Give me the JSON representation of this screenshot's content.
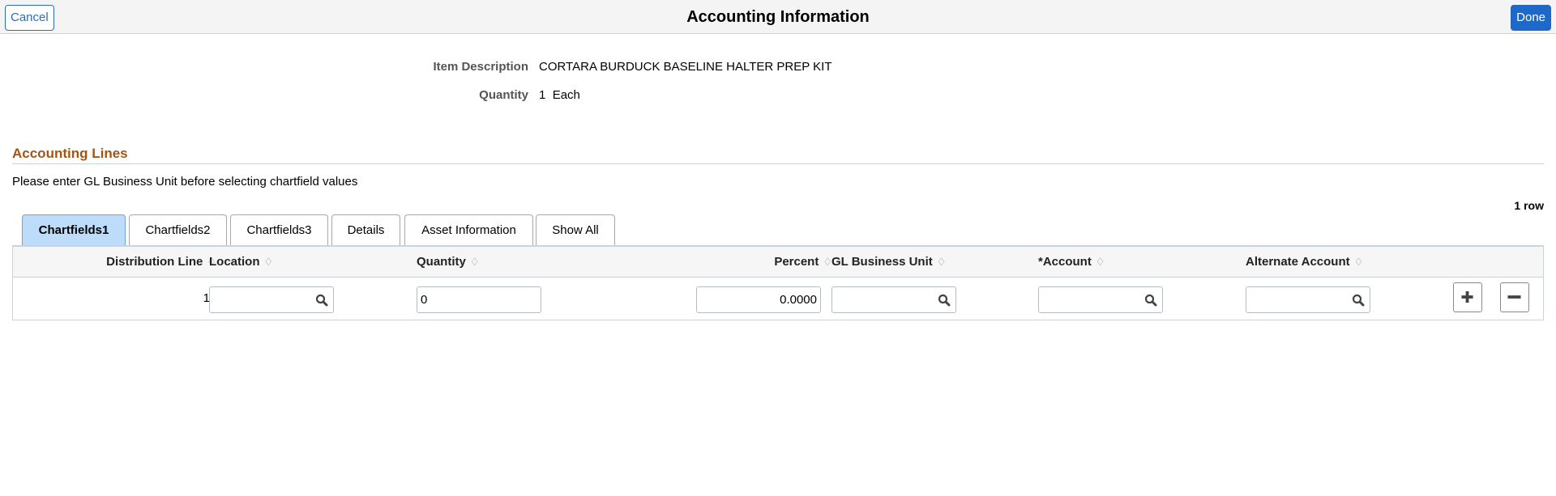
{
  "header": {
    "title": "Accounting Information",
    "cancel_label": "Cancel",
    "done_label": "Done"
  },
  "item_info": {
    "description_label": "Item Description",
    "description_value": "CORTARA BURDUCK BASELINE HALTER PREP KIT",
    "quantity_label": "Quantity",
    "quantity_value": "1",
    "quantity_uom": "Each"
  },
  "accounting_lines": {
    "section_title": "Accounting Lines",
    "instruction": "Please enter GL Business Unit before selecting chartfield values",
    "row_count": "1 row",
    "tabs": [
      {
        "label": "Chartfields1",
        "active": true
      },
      {
        "label": "Chartfields2",
        "active": false
      },
      {
        "label": "Chartfields3",
        "active": false
      },
      {
        "label": "Details",
        "active": false
      },
      {
        "label": "Asset Information",
        "active": false
      },
      {
        "label": "Show All",
        "active": false
      }
    ],
    "columns": [
      {
        "label": "Distribution Line",
        "sort_icon": "sort-updown-icon"
      },
      {
        "label": "Location",
        "sort_icon": "sort-updown-icon"
      },
      {
        "label": "Quantity",
        "sort_icon": "sort-updown-icon"
      },
      {
        "label": "Percent",
        "sort_icon": "sort-updown-icon"
      },
      {
        "label": "GL Business Unit",
        "sort_icon": "sort-updown-icon"
      },
      {
        "label": "*Account",
        "sort_icon": "sort-updown-icon"
      },
      {
        "label": "Alternate Account",
        "sort_icon": "sort-updown-icon"
      }
    ],
    "sort_glyph": "♢",
    "rows": [
      {
        "distribution_line": "1",
        "location": "",
        "quantity": "0",
        "percent": "0.0000",
        "gl_business_unit": "",
        "account": "",
        "alternate_account": ""
      }
    ],
    "add_row_icon": "plus-icon",
    "delete_row_icon": "minus-icon"
  },
  "colors": {
    "accent_blue": "#1d68c8",
    "section_title": "#a45516",
    "active_tab": "#bcdcfa"
  }
}
